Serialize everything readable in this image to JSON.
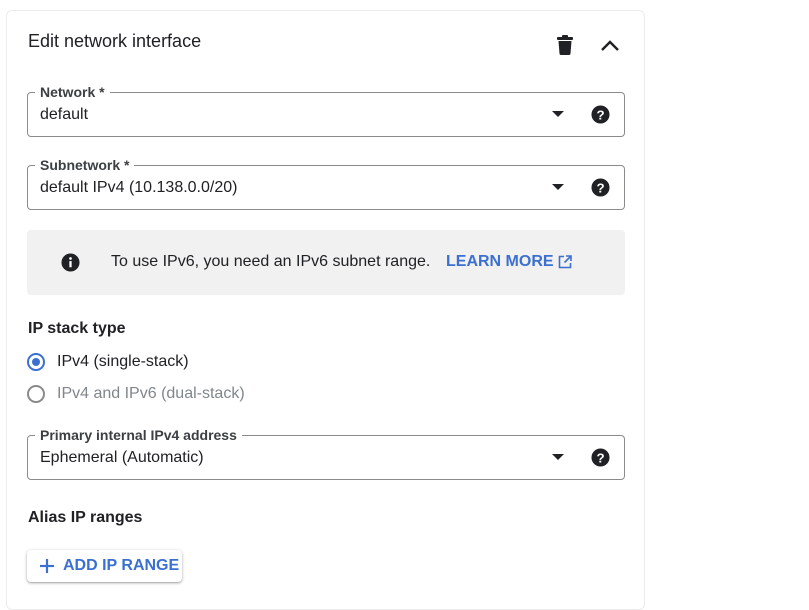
{
  "panel": {
    "title": "Edit network interface",
    "delete_icon": "trash-icon",
    "collapse_icon": "chevron-up-icon"
  },
  "network": {
    "label": "Network *",
    "value": "default"
  },
  "subnetwork": {
    "label": "Subnetwork *",
    "value": "default IPv4 (10.138.0.0/20)"
  },
  "notice": {
    "text": "To use IPv6, you need an IPv6 subnet range.",
    "link_label": "LEARN MORE",
    "icon": "info-icon",
    "link_icon": "external-link-icon"
  },
  "ip_stack": {
    "heading": "IP stack type",
    "options": [
      {
        "label": "IPv4 (single-stack)",
        "selected": true
      },
      {
        "label": "IPv4 and IPv6 (dual-stack)",
        "selected": false
      }
    ]
  },
  "primary_address": {
    "label": "Primary internal IPv4 address",
    "value": "Ephemeral (Automatic)"
  },
  "alias": {
    "heading": "Alias IP ranges",
    "button_label": "ADD IP RANGE"
  },
  "colors": {
    "accent": "#3b6fd0",
    "notice_bg": "#f1f1f1",
    "border": "#8a8a8a"
  }
}
